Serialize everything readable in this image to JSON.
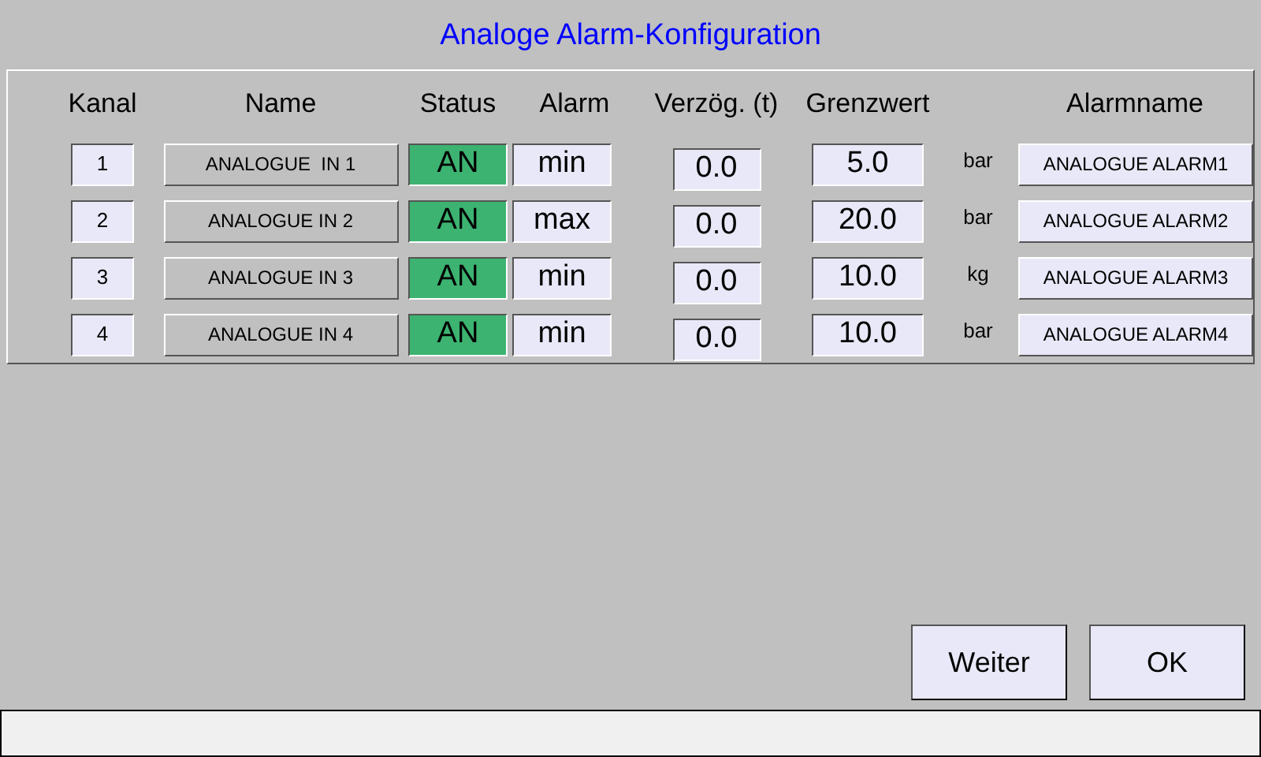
{
  "title": "Analoge Alarm-Konfiguration",
  "table": {
    "columns": [
      "Kanal",
      "Name",
      "Status",
      "Alarm",
      "Verzög. (t)",
      "Grenzwert",
      "Alarmname"
    ],
    "rows": [
      {
        "kanal": "1",
        "name": "ANALOGUE  IN 1",
        "status": "AN",
        "on": true,
        "alarm": "min",
        "delay": "0.0",
        "limit": "5.0",
        "unit": "bar",
        "alarm_name": "ANALOGUE ALARM1"
      },
      {
        "kanal": "2",
        "name": "ANALOGUE IN 2",
        "status": "AN",
        "on": true,
        "alarm": "max",
        "delay": "0.0",
        "limit": "20.0",
        "unit": "bar",
        "alarm_name": "ANALOGUE ALARM2"
      },
      {
        "kanal": "3",
        "name": "ANALOGUE IN 3",
        "status": "AN",
        "on": true,
        "alarm": "min",
        "delay": "0.0",
        "limit": "10.0",
        "unit": "kg",
        "alarm_name": "ANALOGUE ALARM3"
      },
      {
        "kanal": "4",
        "name": "ANALOGUE IN 4",
        "status": "AN",
        "on": true,
        "alarm": "min",
        "delay": "0.0",
        "limit": "10.0",
        "unit": "bar",
        "alarm_name": "ANALOGUE ALARM4"
      }
    ]
  },
  "buttons": [
    "Weiter",
    "OK"
  ]
}
